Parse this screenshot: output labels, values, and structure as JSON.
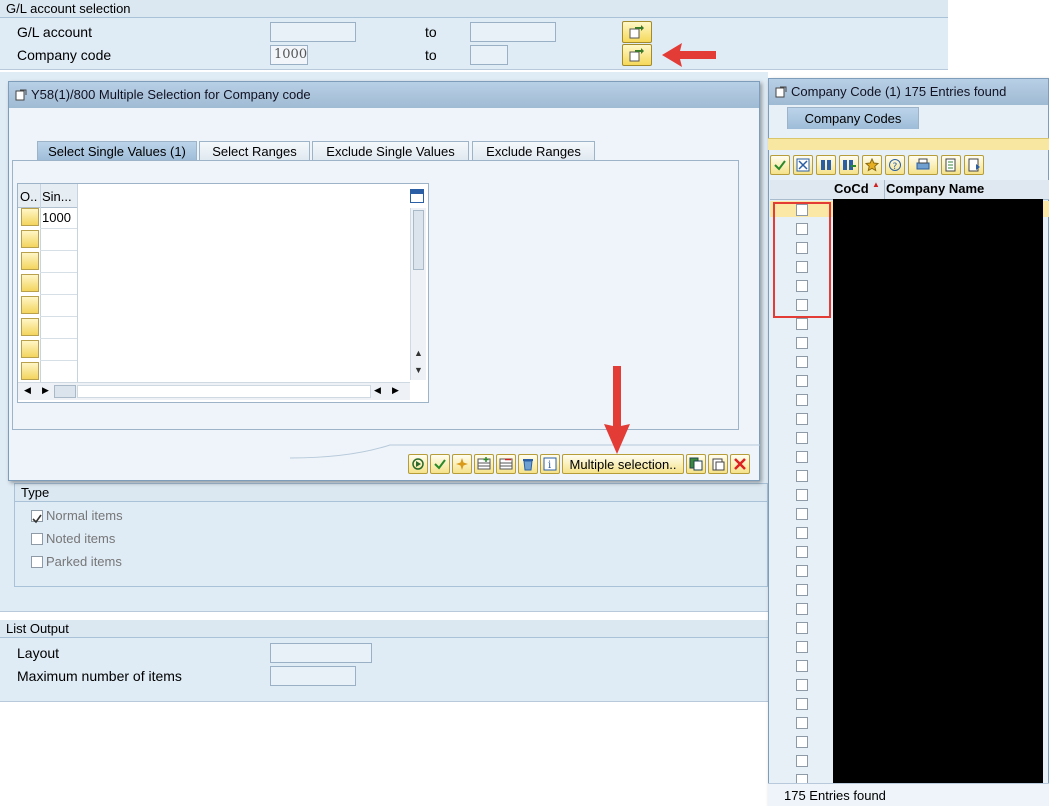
{
  "gl_section": {
    "title": "G/L account selection",
    "gl_account_label": "G/L account",
    "company_code_label": "Company code",
    "company_code_value": "1000",
    "to_label_1": "to",
    "to_label_2": "to"
  },
  "multi_dialog": {
    "title": "Y58(1)/800 Multiple Selection for Company code",
    "tabs": [
      "Select Single Values (1)",
      "Select Ranges",
      "Exclude Single Values",
      "Exclude Ranges"
    ],
    "col_option": "O..",
    "col_single": "Sin...",
    "values": [
      "1000"
    ],
    "multiple_selection_label": "Multiple selection.."
  },
  "type_section": {
    "title": "Type",
    "normal_items": "Normal items",
    "noted_items": "Noted items",
    "parked_items": "Parked items",
    "normal_checked": true
  },
  "list_output": {
    "title": "List Output",
    "layout_label": "Layout",
    "max_items_label": "Maximum number of items"
  },
  "company_dialog": {
    "title": "Company Code (1)  175 Entries found",
    "tab_label": "Company Codes",
    "col_cocd": "CoCd",
    "col_name": "Company Name",
    "footer": "175 Entries found"
  }
}
